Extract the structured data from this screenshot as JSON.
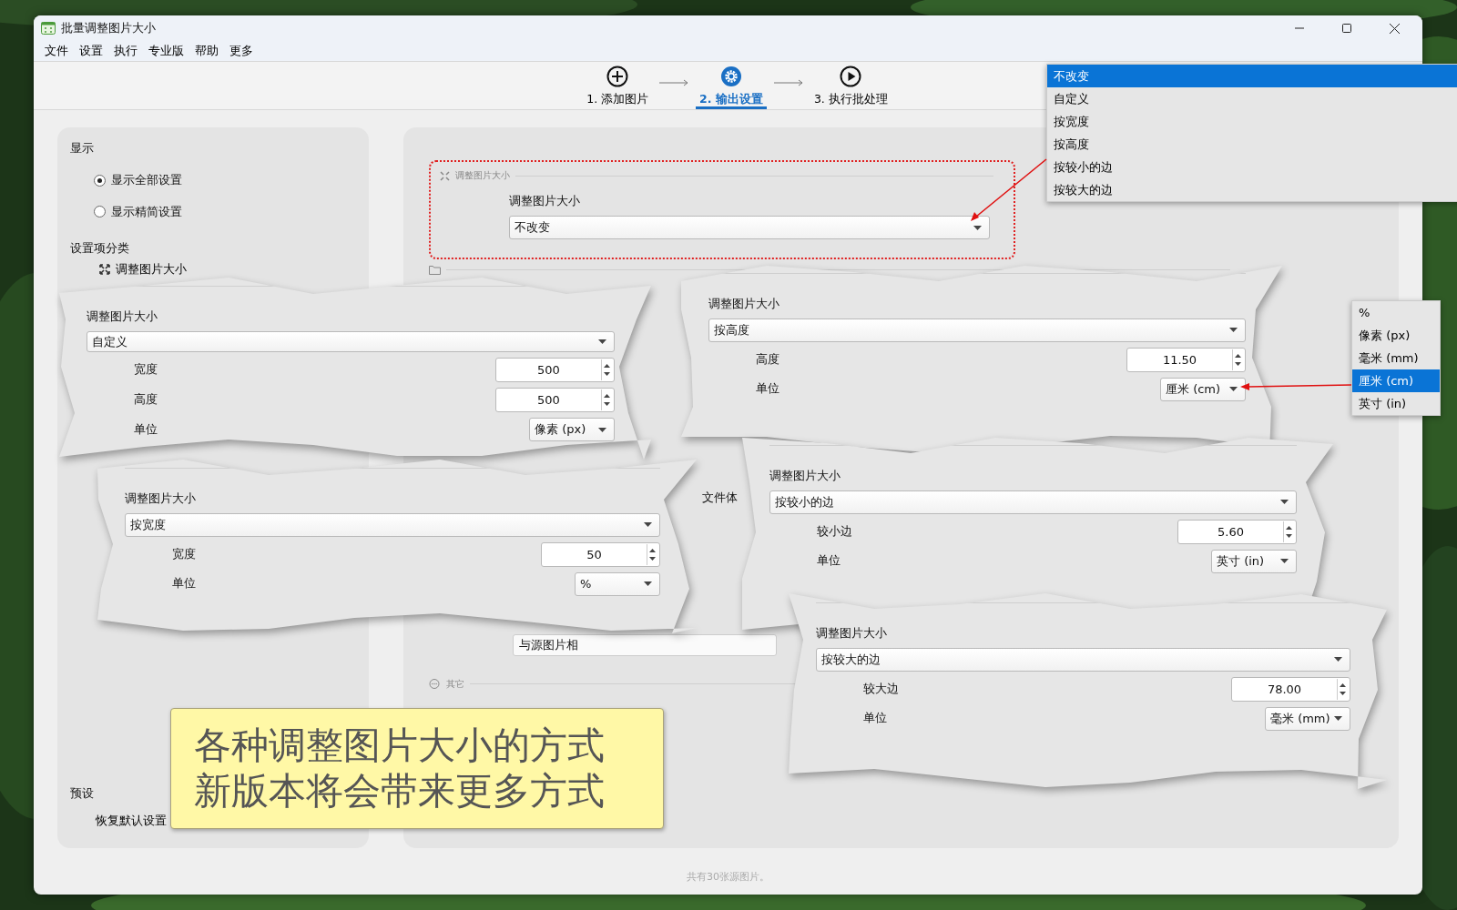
{
  "window": {
    "title": "批量调整图片大小"
  },
  "menu": [
    "文件",
    "设置",
    "执行",
    "专业版",
    "帮助",
    "更多"
  ],
  "steps": [
    {
      "label": "1. 添加图片",
      "selected": false
    },
    {
      "label": "2. 输出设置",
      "selected": true
    },
    {
      "label": "3. 执行批处理",
      "selected": false
    }
  ],
  "left_panel": {
    "display_heading": "显示",
    "display_options": [
      {
        "label": "显示全部设置",
        "selected": true
      },
      {
        "label": "显示精简设置",
        "selected": false
      }
    ],
    "category_heading": "设置项分类",
    "category_item": "调整图片大小",
    "preset_heading": "预设",
    "preset_item": "恢复默认设置"
  },
  "main_panel": {
    "section_title": "调整图片大小",
    "field_label": "调整图片大小",
    "field_value": "不改变",
    "partial_texts": [
      "文件体",
      "与源图片相"
    ],
    "other_section_title": "其它"
  },
  "mode_menu": [
    {
      "label": "不改变",
      "selected": true
    },
    {
      "label": "自定义",
      "selected": false
    },
    {
      "label": "按宽度",
      "selected": false
    },
    {
      "label": "按高度",
      "selected": false
    },
    {
      "label": "按较小的边",
      "selected": false
    },
    {
      "label": "按较大的边",
      "selected": false
    }
  ],
  "unit_menu": [
    {
      "label": "%",
      "selected": false
    },
    {
      "label": "像素 (px)",
      "selected": false
    },
    {
      "label": "毫米 (mm)",
      "selected": false
    },
    {
      "label": "厘米 (cm)",
      "selected": true
    },
    {
      "label": "英寸 (in)",
      "selected": false
    }
  ],
  "cutouts": [
    {
      "title": "调整图片大小",
      "mode": "自定义",
      "fields": [
        {
          "label": "宽度",
          "kind": "spin",
          "value": "500"
        },
        {
          "label": "高度",
          "kind": "spin",
          "value": "500"
        },
        {
          "label": "单位",
          "kind": "select",
          "value": "像素 (px)"
        }
      ]
    },
    {
      "title": "调整图片大小",
      "mode": "按高度",
      "fields": [
        {
          "label": "高度",
          "kind": "spin",
          "value": "11.50"
        },
        {
          "label": "单位",
          "kind": "select",
          "value": "厘米 (cm)"
        }
      ]
    },
    {
      "title": "调整图片大小",
      "mode": "按宽度",
      "fields": [
        {
          "label": "宽度",
          "kind": "spin",
          "value": "50"
        },
        {
          "label": "单位",
          "kind": "select",
          "value": "%"
        }
      ]
    },
    {
      "title": "调整图片大小",
      "mode": "按较小的边",
      "fields": [
        {
          "label": "较小边",
          "kind": "spin",
          "value": "5.60"
        },
        {
          "label": "单位",
          "kind": "select",
          "value": "英寸 (in)"
        }
      ]
    },
    {
      "title": "调整图片大小",
      "mode": "按较大的边",
      "fields": [
        {
          "label": "较大边",
          "kind": "spin",
          "value": "78.00"
        },
        {
          "label": "单位",
          "kind": "select",
          "value": "毫米 (mm)"
        }
      ]
    }
  ],
  "callout": [
    "各种调整图片大小的方式",
    "新版本将会带来更多方式"
  ],
  "status_bar": "共有30张源图片。"
}
